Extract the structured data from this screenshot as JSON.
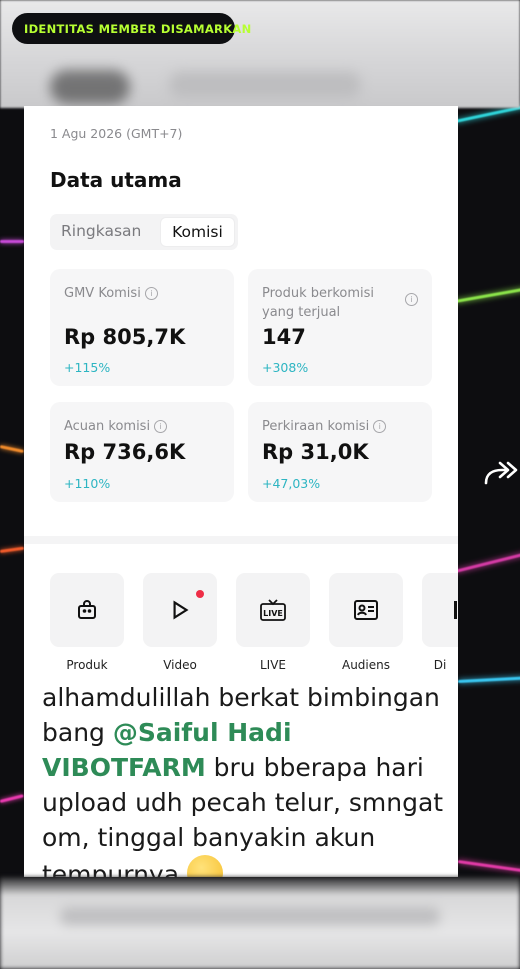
{
  "badge": {
    "label": "IDENTITAS MEMBER DISAMARKAN"
  },
  "report": {
    "date": "1 Agu 2026 (GMT+7)",
    "title": "Data utama",
    "tabs": [
      "Ringkasan",
      "Komisi"
    ],
    "active_tab": "Komisi"
  },
  "metrics": [
    {
      "label": "GMV Komisi",
      "value": "Rp 805,7K",
      "change": "+115%"
    },
    {
      "label": "Produk berkomisi yang terjual",
      "value": "147",
      "change": "+308%"
    },
    {
      "label": "Acuan komisi",
      "value": "Rp 736,6K",
      "change": "+110%"
    },
    {
      "label": "Perkiraan komisi",
      "value": "Rp 31,0K",
      "change": "+47,03%"
    }
  ],
  "tools": [
    {
      "label": "Produk",
      "icon": "shopping-bag-icon"
    },
    {
      "label": "Video",
      "icon": "play-video-icon"
    },
    {
      "label": "LIVE",
      "icon": "live-tv-icon"
    },
    {
      "label": "Audiens",
      "icon": "id-card-icon"
    },
    {
      "label": "Di",
      "icon": "more-tool-icon"
    }
  ],
  "caption": {
    "line_start": "alhamdulillah berkat bimbingan bang ",
    "mention": "@Saiful Hadi VIBOTFARM",
    "line_end": " bru bberapa hari upload udh pecah telur, smngat om, tinggal banyakin akun tempurnya"
  },
  "colors": {
    "badge_text": "#b7ff32",
    "change_text": "#2db5c2",
    "mention": "#2e8b57",
    "notification_dot": "#ee2d46"
  },
  "icons": {
    "share": "share-arrow-icon",
    "info": "info-icon"
  }
}
